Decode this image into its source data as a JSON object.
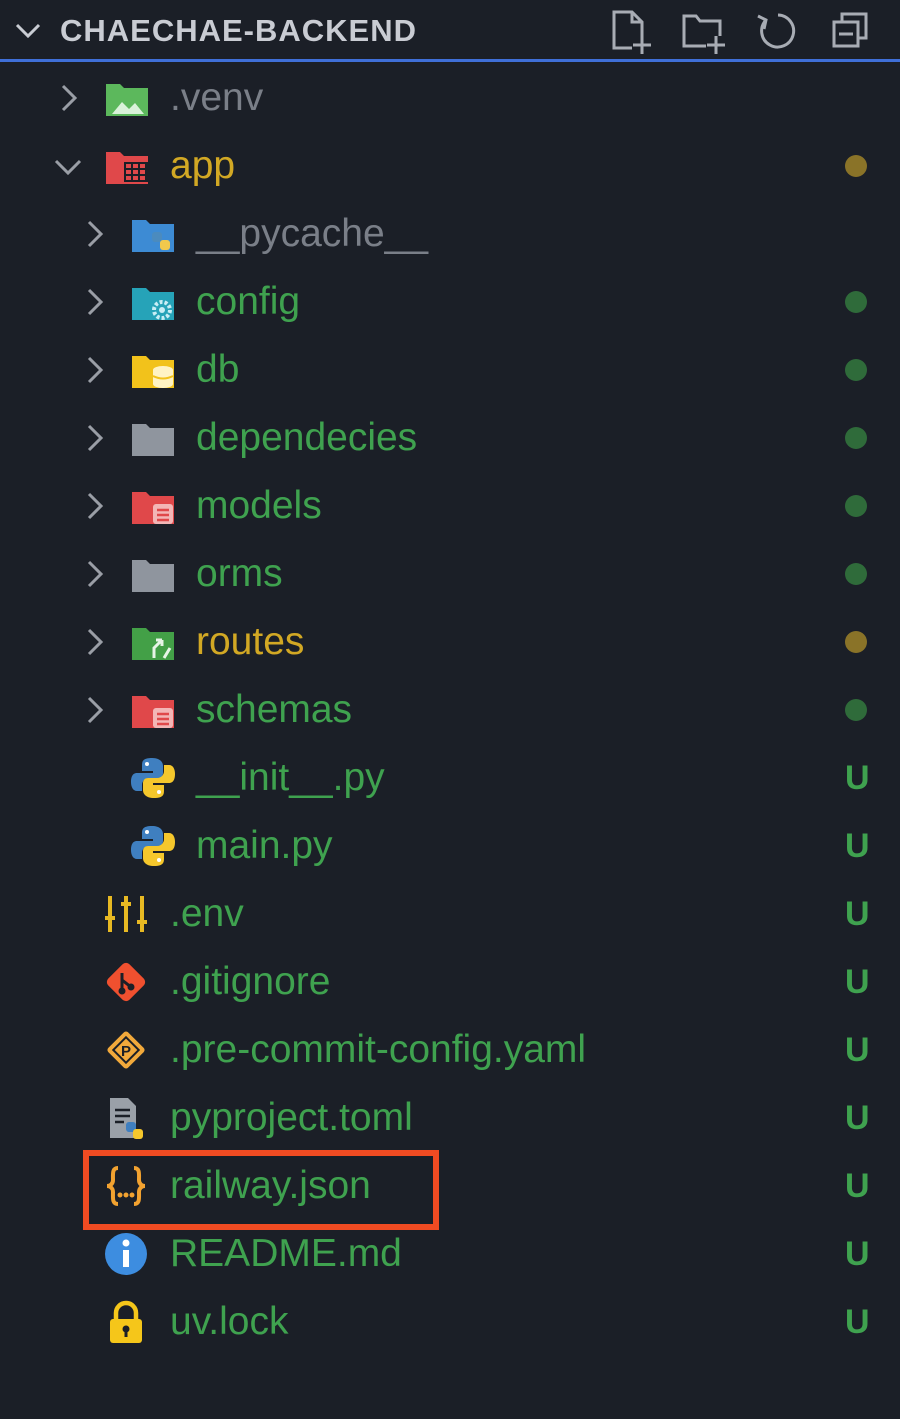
{
  "explorer": {
    "title": "CHAECHAE-BACKEND",
    "actions": [
      {
        "name": "new-file-icon"
      },
      {
        "name": "new-folder-icon"
      },
      {
        "name": "refresh-icon"
      },
      {
        "name": "collapse-all-icon"
      }
    ]
  },
  "colors": {
    "accent": "#3f6fd8",
    "modified": "#d2a824",
    "untracked": "#3fa24f",
    "ignored": "#7a7f88",
    "highlight": "#f04b22"
  },
  "tree": [
    {
      "label": ".venv",
      "kind": "folder",
      "icon": "venv-folder-icon",
      "state": "ignored",
      "expanded": false
    },
    {
      "label": "app",
      "kind": "folder",
      "icon": "app-folder-icon",
      "state": "modified",
      "expanded": true
    },
    {
      "label": "__pycache__",
      "kind": "folder",
      "icon": "python-folder-icon",
      "state": "ignored",
      "expanded": false
    },
    {
      "label": "config",
      "kind": "folder",
      "icon": "config-folder-icon",
      "state": "untracked",
      "expanded": false
    },
    {
      "label": "db",
      "kind": "folder",
      "icon": "database-folder-icon",
      "state": "untracked",
      "expanded": false
    },
    {
      "label": "dependecies",
      "kind": "folder",
      "icon": "folder-icon",
      "state": "untracked",
      "expanded": false
    },
    {
      "label": "models",
      "kind": "folder",
      "icon": "models-folder-icon",
      "state": "untracked",
      "expanded": false
    },
    {
      "label": "orms",
      "kind": "folder",
      "icon": "folder-icon",
      "state": "untracked",
      "expanded": false
    },
    {
      "label": "routes",
      "kind": "folder",
      "icon": "routes-folder-icon",
      "state": "modified",
      "expanded": false
    },
    {
      "label": "schemas",
      "kind": "folder",
      "icon": "schemas-folder-icon",
      "state": "untracked",
      "expanded": false
    },
    {
      "label": "__init__.py",
      "kind": "file",
      "icon": "python-icon",
      "state": "untracked",
      "status": "U"
    },
    {
      "label": "main.py",
      "kind": "file",
      "icon": "python-icon",
      "state": "untracked",
      "status": "U"
    },
    {
      "label": ".env",
      "kind": "file",
      "icon": "env-settings-icon",
      "state": "untracked",
      "status": "U"
    },
    {
      "label": ".gitignore",
      "kind": "file",
      "icon": "git-icon",
      "state": "untracked",
      "status": "U"
    },
    {
      "label": ".pre-commit-config.yaml",
      "kind": "file",
      "icon": "pre-commit-icon",
      "state": "untracked",
      "status": "U"
    },
    {
      "label": "pyproject.toml",
      "kind": "file",
      "icon": "pyproject-icon",
      "state": "untracked",
      "status": "U"
    },
    {
      "label": "railway.json",
      "kind": "file",
      "icon": "json-braces-icon",
      "state": "untracked",
      "status": "U"
    },
    {
      "label": "README.md",
      "kind": "file",
      "icon": "info-icon",
      "state": "untracked",
      "status": "U"
    },
    {
      "label": "uv.lock",
      "kind": "file",
      "icon": "lock-icon",
      "state": "untracked",
      "status": "U"
    }
  ]
}
